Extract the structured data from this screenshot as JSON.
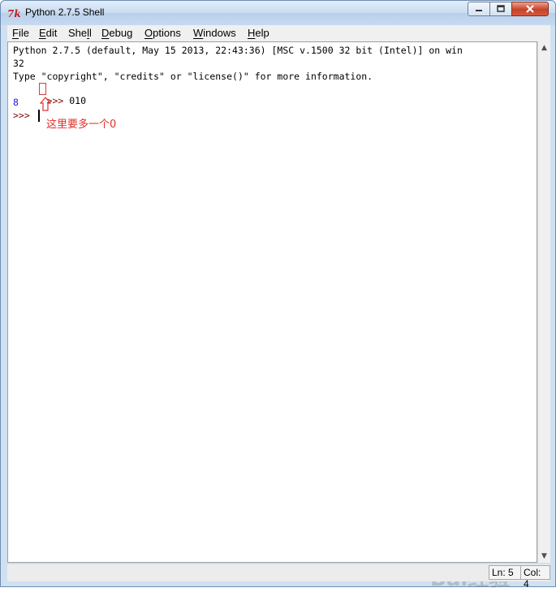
{
  "window": {
    "title": "Python 2.7.5 Shell",
    "icons": {
      "app": "tk-feather-icon",
      "minimize": "minimize-icon",
      "maximize": "maximize-icon",
      "close": "close-icon"
    }
  },
  "menu": [
    {
      "u": "F",
      "rest": "ile"
    },
    {
      "u": "E",
      "rest": "dit"
    },
    {
      "pre": "She",
      "u": "l",
      "rest": "l"
    },
    {
      "u": "D",
      "rest": "ebug"
    },
    {
      "u": "O",
      "rest": "ptions"
    },
    {
      "u": "W",
      "rest": "indows"
    },
    {
      "u": "H",
      "rest": "elp"
    }
  ],
  "shell": {
    "banner_line1": "Python 2.7.5 (default, May 15 2013, 22:43:36) [MSC v.1500 32 bit (Intel)] on win",
    "banner_line2": "32",
    "banner_line3": "Type \"copyright\", \"credits\" or \"license()\" for more information.",
    "prompt": ">>> ",
    "input1": "010",
    "output1": "8",
    "prompt2": ">>> "
  },
  "annotation": {
    "text": "这里要多一个0",
    "color": "#e0302a"
  },
  "status": {
    "line": "Ln: 5",
    "col": "Col: 4"
  },
  "watermark": "Bai经验"
}
